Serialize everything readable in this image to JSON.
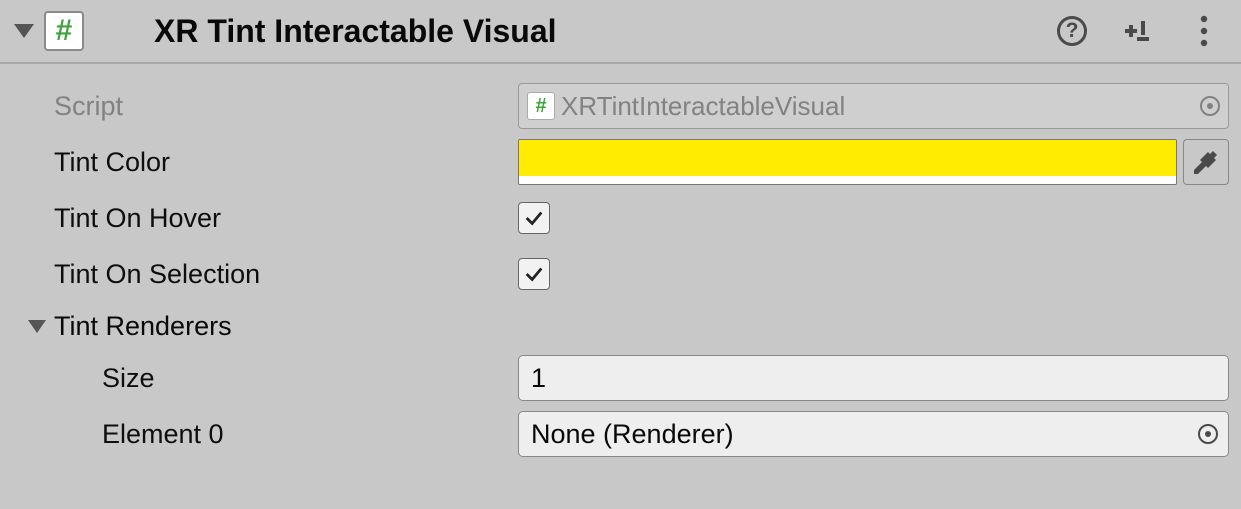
{
  "header": {
    "title": "XR Tint Interactable Visual"
  },
  "fields": {
    "script": {
      "label": "Script",
      "value": "XRTintInteractableVisual"
    },
    "tintColor": {
      "label": "Tint Color",
      "hex": "#ffec00"
    },
    "tintOnHover": {
      "label": "Tint On Hover",
      "checked": true
    },
    "tintOnSelection": {
      "label": "Tint On Selection",
      "checked": true
    },
    "tintRenderers": {
      "label": "Tint Renderers",
      "sizeLabel": "Size",
      "size": "1",
      "elements": [
        {
          "label": "Element 0",
          "value": "None (Renderer)"
        }
      ]
    }
  }
}
